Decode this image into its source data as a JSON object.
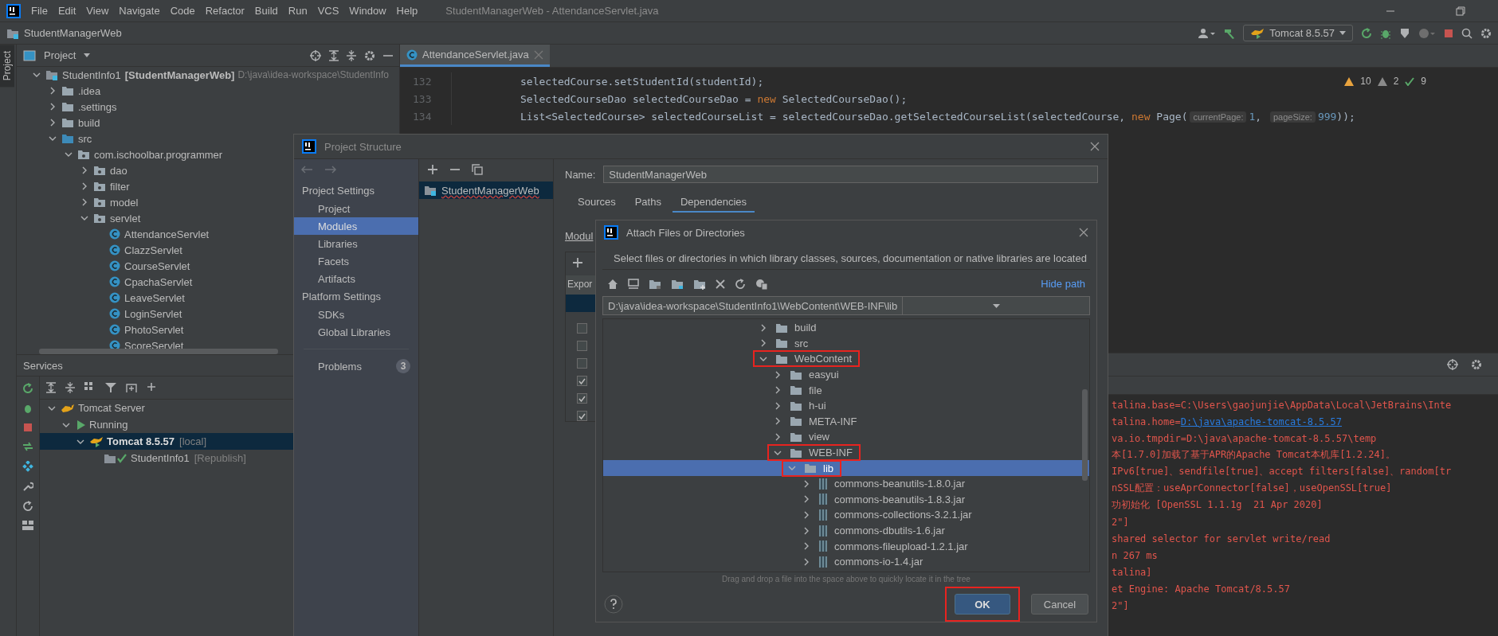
{
  "menu_bar": {
    "items": [
      "File",
      "Edit",
      "View",
      "Navigate",
      "Code",
      "Refactor",
      "Build",
      "Run",
      "VCS",
      "Window",
      "Help"
    ],
    "title": "StudentManagerWeb - AttendanceServlet.java"
  },
  "nav_bar": {
    "project": "StudentManagerWeb",
    "run_config": "Tomcat 8.5.57"
  },
  "tool_stripe": {
    "tabs": [
      {
        "label": "Project",
        "selected": true
      }
    ]
  },
  "project_panel": {
    "title": "Project",
    "tree": [
      {
        "kind": "module",
        "name": "StudentInfo1",
        "module": "[StudentManagerWeb]",
        "path": "D:\\java\\idea-workspace\\StudentInfo",
        "expanded": true,
        "children": [
          {
            "kind": "folder",
            "name": ".idea",
            "expanded": false
          },
          {
            "kind": "folder",
            "name": ".settings",
            "expanded": false
          },
          {
            "kind": "folder",
            "name": "build",
            "expanded": false
          },
          {
            "kind": "source-folder",
            "name": "src",
            "expanded": true,
            "children": [
              {
                "kind": "package",
                "name": "com.ischoolbar.programmer",
                "expanded": true,
                "children": [
                  {
                    "kind": "package",
                    "name": "dao",
                    "expanded": false
                  },
                  {
                    "kind": "package",
                    "name": "filter",
                    "expanded": false
                  },
                  {
                    "kind": "package",
                    "name": "model",
                    "expanded": false
                  },
                  {
                    "kind": "package",
                    "name": "servlet",
                    "expanded": true,
                    "children": [
                      {
                        "kind": "class",
                        "name": "AttendanceServlet"
                      },
                      {
                        "kind": "class",
                        "name": "ClazzServlet"
                      },
                      {
                        "kind": "class",
                        "name": "CourseServlet"
                      },
                      {
                        "kind": "class",
                        "name": "CpachaServlet"
                      },
                      {
                        "kind": "class",
                        "name": "LeaveServlet"
                      },
                      {
                        "kind": "class",
                        "name": "LoginServlet"
                      },
                      {
                        "kind": "class",
                        "name": "PhotoServlet"
                      },
                      {
                        "kind": "class",
                        "name": "ScoreServlet"
                      }
                    ]
                  }
                ]
              }
            ]
          }
        ]
      }
    ]
  },
  "services_panel": {
    "title": "Services",
    "tree": [
      {
        "kind": "server",
        "name": "Tomcat Server",
        "expanded": true,
        "selected": false,
        "children": [
          {
            "kind": "running",
            "name": "Running",
            "expanded": true,
            "selected": false,
            "children": [
              {
                "kind": "tomcat",
                "name": "Tomcat 8.5.57",
                "note": "[local]",
                "expanded": true,
                "selected": true,
                "children": [
                  {
                    "kind": "artifact",
                    "name": "StudentInfo1",
                    "note": "[Republish]",
                    "selected": false
                  }
                ]
              }
            ]
          }
        ]
      }
    ]
  },
  "editor": {
    "tabs": [
      {
        "label": "AttendanceServlet.java",
        "selected": true
      }
    ],
    "inspections": [
      {
        "kind": "warning",
        "count": "10"
      },
      {
        "kind": "weak",
        "count": "2"
      },
      {
        "kind": "typo",
        "count": "9"
      }
    ],
    "lines": [
      {
        "number": "132",
        "tokens": [
          {
            "kind": "plain",
            "text": "selectedCourse.setStudentId(studentId);"
          }
        ]
      },
      {
        "number": "133",
        "tokens": [
          {
            "kind": "plain",
            "text": "SelectedCourseDao selectedCourseDao = "
          },
          {
            "kind": "keyword",
            "text": "new"
          },
          {
            "kind": "plain",
            "text": " SelectedCourseDao();"
          }
        ]
      },
      {
        "number": "134",
        "tokens": [
          {
            "kind": "plain",
            "text": "List<SelectedCourse> selectedCourseList = selectedCourseDao.getSelectedCourseList(selectedCourse, "
          },
          {
            "kind": "keyword",
            "text": "new"
          },
          {
            "kind": "plain",
            "text": " Page("
          },
          {
            "kind": "hint",
            "text": "currentPage:"
          },
          {
            "kind": "number",
            "text": "1"
          },
          {
            "kind": "plain",
            "text": ", "
          },
          {
            "kind": "hint",
            "text": "pageSize:"
          },
          {
            "kind": "number",
            "text": "999"
          },
          {
            "kind": "plain",
            "text": "));"
          }
        ]
      }
    ]
  },
  "console": {
    "lines": [
      {
        "text": "talina.base=C:\\Users\\gaojunjie\\AppData\\Local\\JetBrains\\Inte"
      },
      {
        "text": "talina.home=",
        "link": "D:\\java\\apache-tomcat-8.5.57"
      },
      {
        "text": "va.io.tmpdir=D:\\java\\apache-tomcat-8.5.57\\temp"
      },
      {
        "text": "本[1.7.0]加载了基于APR的Apache Tomcat本机库[1.2.24]。"
      },
      {
        "text": "IPv6[true]、sendfile[true]、accept filters[false]、random[tr"
      },
      {
        "text": "nSSL配置：useAprConnector[false]，useOpenSSL[true]"
      },
      {
        "text": "功初始化 [OpenSSL 1.1.1g  21 Apr 2020]"
      },
      {
        "text": "2\"]"
      },
      {
        "text": "shared selector for servlet write/read"
      },
      {
        "text": "n 267 ms"
      },
      {
        "text": "talina]"
      },
      {
        "text": "et Engine: Apache Tomcat/8.5.57"
      },
      {
        "text": "2\"]"
      }
    ]
  },
  "project_structure": {
    "title": "Project Structure",
    "groups": [
      {
        "heading": "Project Settings",
        "items": [
          {
            "label": "Project",
            "selected": false
          },
          {
            "label": "Modules",
            "selected": true
          },
          {
            "label": "Libraries",
            "selected": false
          },
          {
            "label": "Facets",
            "selected": false
          },
          {
            "label": "Artifacts",
            "selected": false
          }
        ]
      },
      {
        "heading": "Platform Settings",
        "items": [
          {
            "label": "SDKs",
            "selected": false
          },
          {
            "label": "Global Libraries",
            "selected": false
          }
        ]
      }
    ],
    "problems": {
      "label": "Problems",
      "count": "3"
    },
    "modules": [
      {
        "name": "StudentManagerWeb",
        "selected": true
      }
    ],
    "name_label": "Name:",
    "name_value": "StudentManagerWeb",
    "tabs": [
      {
        "label": "Sources",
        "selected": false
      },
      {
        "label": "Paths",
        "selected": false
      },
      {
        "label": "Dependencies",
        "selected": true
      }
    ],
    "module_label": "Modul",
    "table_header": "Expor",
    "dependencies": [
      {
        "checked": false
      },
      {
        "checked": false
      },
      {
        "checked": false
      },
      {
        "checked": true
      },
      {
        "checked": true
      },
      {
        "checked": true
      }
    ]
  },
  "attach_dialog": {
    "title": "Attach Files or Directories",
    "description": "Select files or directories in which library classes, sources, documentation or native libraries are located",
    "hide_path": "Hide path",
    "path": "D:\\java\\idea-workspace\\StudentInfo1\\WebContent\\WEB-INF\\lib",
    "tree": [
      {
        "kind": "folder",
        "name": "build",
        "expanded": false,
        "selected": false,
        "marked": false
      },
      {
        "kind": "folder",
        "name": "src",
        "expanded": false,
        "selected": false,
        "marked": false
      },
      {
        "kind": "folder",
        "name": "WebContent",
        "expanded": true,
        "selected": false,
        "marked": true,
        "children": [
          {
            "kind": "folder",
            "name": "easyui",
            "expanded": false,
            "selected": false,
            "marked": false
          },
          {
            "kind": "folder",
            "name": "file",
            "expanded": false,
            "selected": false,
            "marked": false
          },
          {
            "kind": "folder",
            "name": "h-ui",
            "expanded": false,
            "selected": false,
            "marked": false
          },
          {
            "kind": "folder",
            "name": "META-INF",
            "expanded": false,
            "selected": false,
            "marked": false
          },
          {
            "kind": "folder",
            "name": "view",
            "expanded": false,
            "selected": false,
            "marked": false
          },
          {
            "kind": "folder",
            "name": "WEB-INF",
            "expanded": true,
            "selected": false,
            "marked": true,
            "children": [
              {
                "kind": "folder",
                "name": "lib",
                "expanded": true,
                "selected": true,
                "marked": true,
                "children": [
                  {
                    "kind": "jar",
                    "name": "commons-beanutils-1.8.0.jar",
                    "expanded": false,
                    "selected": false,
                    "marked": false
                  },
                  {
                    "kind": "jar",
                    "name": "commons-beanutils-1.8.3.jar",
                    "expanded": false,
                    "selected": false,
                    "marked": false
                  },
                  {
                    "kind": "jar",
                    "name": "commons-collections-3.2.1.jar",
                    "expanded": false,
                    "selected": false,
                    "marked": false
                  },
                  {
                    "kind": "jar",
                    "name": "commons-dbutils-1.6.jar",
                    "expanded": false,
                    "selected": false,
                    "marked": false
                  },
                  {
                    "kind": "jar",
                    "name": "commons-fileupload-1.2.1.jar",
                    "expanded": false,
                    "selected": false,
                    "marked": false
                  },
                  {
                    "kind": "jar",
                    "name": "commons-io-1.4.jar",
                    "expanded": false,
                    "selected": false,
                    "marked": false
                  }
                ]
              }
            ]
          }
        ]
      }
    ],
    "hint": "Drag and drop a file into the space above to quickly locate it in the tree",
    "ok": {
      "label": "OK",
      "marked": true
    },
    "cancel": "Cancel"
  }
}
